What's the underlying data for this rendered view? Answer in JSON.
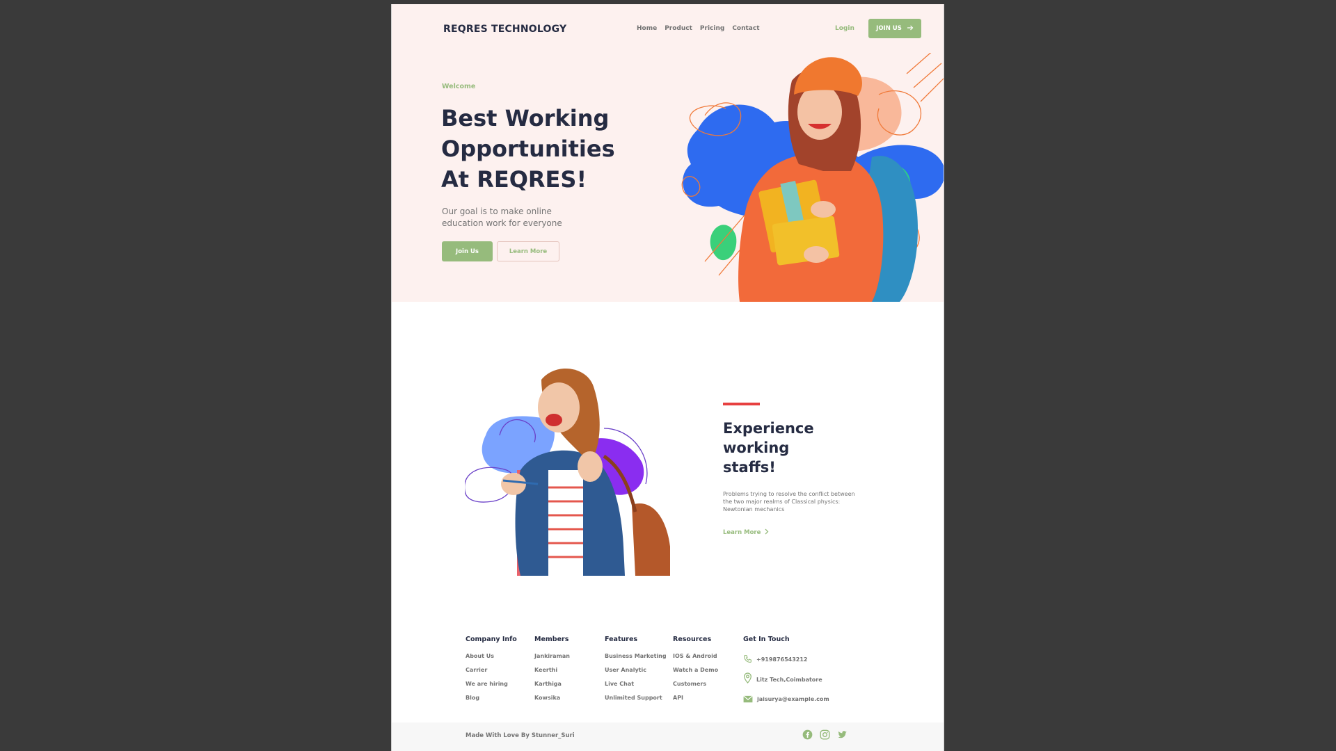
{
  "brand": "REQRES TECHNOLOGY",
  "nav": [
    "Home",
    "Product",
    "Pricing",
    "Contact"
  ],
  "header": {
    "login": "Login",
    "join": "JOIN US"
  },
  "hero": {
    "eyebrow": "Welcome",
    "headline": [
      "Best Working",
      "Opportunities",
      "At REQRES!"
    ],
    "subtitle": "Our goal is to make online education work for everyone",
    "primary_button": "Join Us",
    "secondary_button": "Learn More"
  },
  "feature": {
    "title": [
      "Experience",
      "working",
      "staffs!"
    ],
    "text": "Problems trying to resolve the conflict between the two major realms of Classical physics: Newtonian mechanics",
    "link": "Learn More"
  },
  "footer": {
    "columns": [
      {
        "title": "Company Info",
        "items": [
          "About Us",
          "Carrier",
          "We are hiring",
          "Blog"
        ]
      },
      {
        "title": "Members",
        "items": [
          "Jankiraman",
          "Keerthi",
          "Karthiga",
          "Kowsika"
        ]
      },
      {
        "title": "Features",
        "items": [
          "Business Marketing",
          "User Analytic",
          "Live Chat",
          "Unlimited Support"
        ]
      },
      {
        "title": "Resources",
        "items": [
          "IOS & Android",
          "Watch a Demo",
          "Customers",
          "API"
        ]
      }
    ],
    "contact": {
      "title": "Get In Touch",
      "phone": "+919876543212",
      "address": "Litz Tech,Coimbatore",
      "email": "jaisurya@example.com"
    },
    "made_by": "Made With Love By Stunner_Suri",
    "socials": [
      "facebook-icon",
      "instagram-icon",
      "twitter-icon"
    ]
  },
  "colors": {
    "accent": "#96bb7c",
    "heading": "#252b42",
    "muted": "#737373",
    "hero_bg": "#fdf1ef",
    "red": "#e74040"
  }
}
